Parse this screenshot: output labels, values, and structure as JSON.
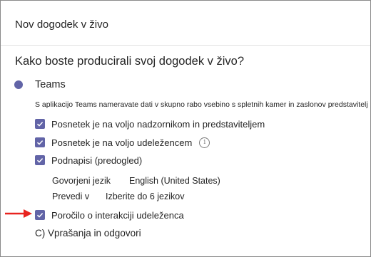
{
  "dialog": {
    "title": "Nov dogodek v živo"
  },
  "question": "Kako boste producirali svoj dogodek v živo?",
  "option": {
    "label": "Teams",
    "description": "S aplikacijo Teams nameravate dati v skupno rabo vsebino s spletnih kamer in zaslonov predstavitelj"
  },
  "checkboxes": [
    {
      "label": "Posnetek je na voljo nadzornikom in predstaviteljem",
      "checked": true
    },
    {
      "label": "Posnetek je na voljo udeležencem",
      "checked": true
    },
    {
      "label": "Podnapisi (predogled)",
      "checked": true
    },
    {
      "label": "Poročilo o interakciji udeleženca",
      "checked": true
    }
  ],
  "captions": {
    "spoken_language_label": "Govorjeni jezik",
    "spoken_language_value": "English (United States)",
    "translate_label": "Prevedi v",
    "translate_value": "Izberite do 6 jezikov"
  },
  "qa_label": "C) Vprašanja in odgovori",
  "colors": {
    "accent": "#6264a7",
    "arrow": "#e8231f"
  },
  "icons": {
    "info": "info-icon",
    "arrow": "red-arrow-icon",
    "check": "checkmark-icon"
  }
}
